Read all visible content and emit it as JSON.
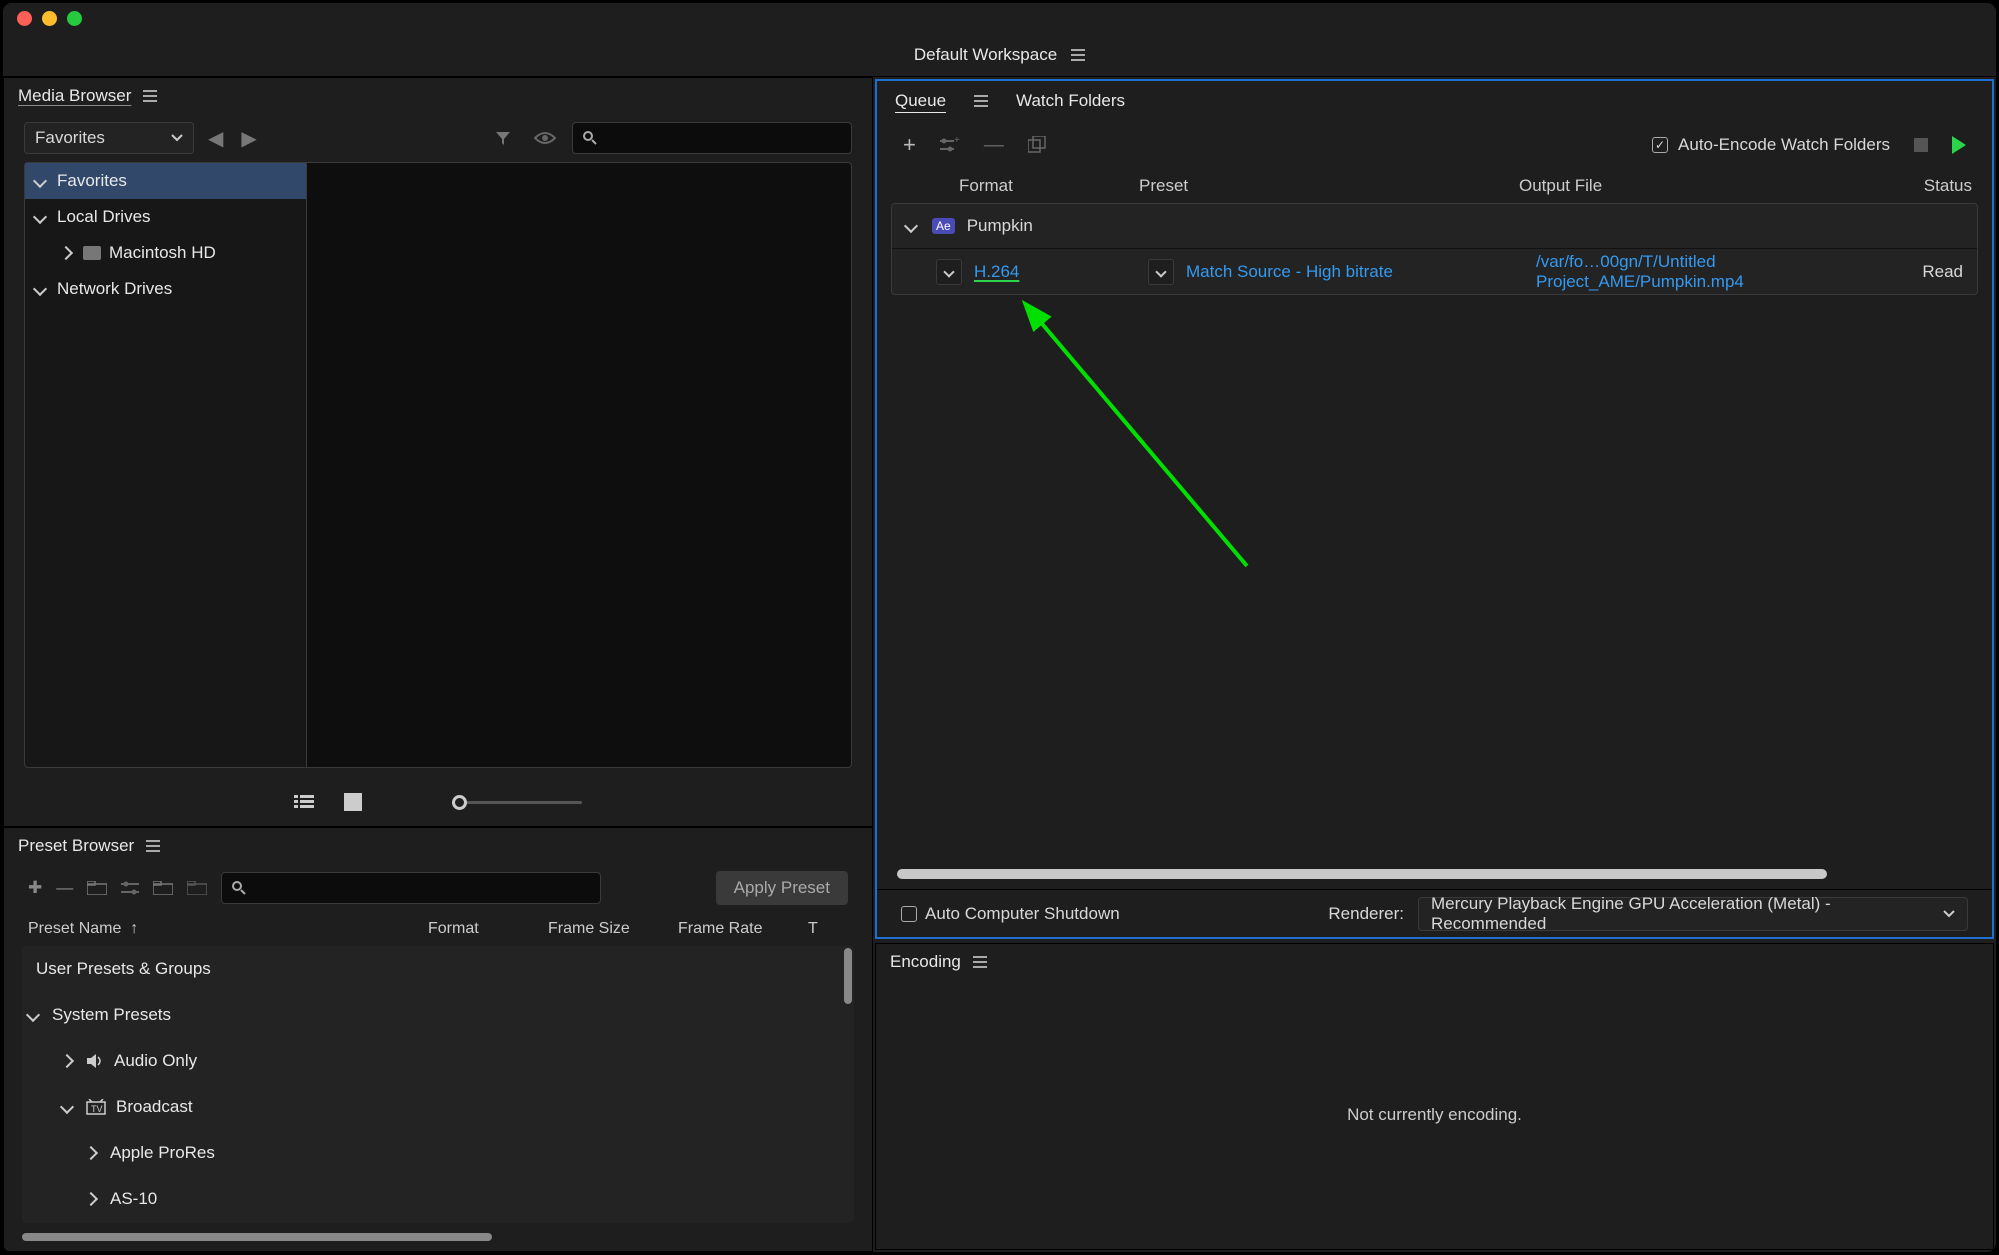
{
  "workspace": {
    "title": "Default Workspace"
  },
  "mediaBrowser": {
    "title": "Media Browser",
    "favoritesDropdown": "Favorites",
    "searchPlaceholder": "",
    "tree": {
      "favorites": "Favorites",
      "localDrives": "Local Drives",
      "macHD": "Macintosh HD",
      "networkDrives": "Network Drives"
    }
  },
  "presetBrowser": {
    "title": "Preset Browser",
    "applyButton": "Apply Preset",
    "headers": {
      "name": "Preset Name",
      "format": "Format",
      "frameSize": "Frame Size",
      "frameRate": "Frame Rate",
      "t": "T"
    },
    "rows": {
      "userPresets": "User Presets & Groups",
      "systemPresets": "System Presets",
      "audioOnly": "Audio Only",
      "broadcast": "Broadcast",
      "appleProRes": "Apple ProRes",
      "as10": "AS-10"
    }
  },
  "queue": {
    "tabs": {
      "queue": "Queue",
      "watchFolders": "Watch Folders"
    },
    "autoEncode": "Auto-Encode Watch Folders",
    "headers": {
      "format": "Format",
      "preset": "Preset",
      "output": "Output File",
      "status": "Status"
    },
    "group": {
      "app": "Ae",
      "name": "Pumpkin"
    },
    "item": {
      "format": "H.264",
      "preset": "Match Source - High bitrate",
      "output": "/var/fo…00gn/T/Untitled Project_AME/Pumpkin.mp4",
      "status": "Read"
    },
    "footer": {
      "autoShutdown": "Auto Computer Shutdown",
      "rendererLabel": "Renderer:",
      "rendererValue": "Mercury Playback Engine GPU Acceleration (Metal) - Recommended"
    }
  },
  "encoding": {
    "title": "Encoding",
    "message": "Not currently encoding."
  }
}
